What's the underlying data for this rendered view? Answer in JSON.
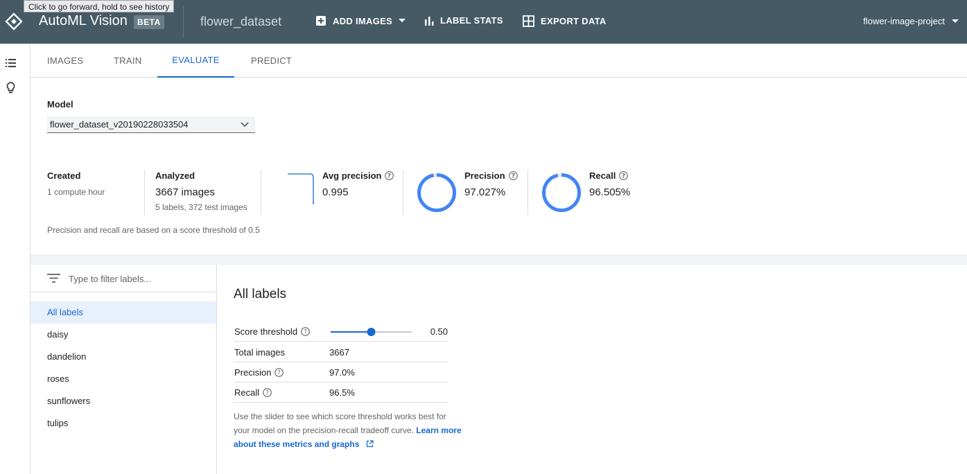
{
  "tooltip": "Click to go forward, hold to see history",
  "app": {
    "title": "AutoML Vision",
    "badge": "BETA",
    "dataset": "flower_dataset",
    "project": "flower-image-project"
  },
  "toolbar": {
    "add_images": "ADD IMAGES",
    "label_stats": "LABEL STATS",
    "export_data": "EXPORT DATA"
  },
  "tabs": [
    "IMAGES",
    "TRAIN",
    "EVALUATE",
    "PREDICT"
  ],
  "active_tab": "EVALUATE",
  "model": {
    "label": "Model",
    "value": "flower_dataset_v20190228033504"
  },
  "stats": {
    "created": {
      "title": "Created",
      "value": "1 compute hour"
    },
    "analyzed": {
      "title": "Analyzed",
      "value": "3667 images",
      "sub": "5 labels, 372 test images"
    },
    "avg_precision": {
      "title": "Avg precision",
      "value": "0.995"
    },
    "precision": {
      "title": "Precision",
      "value": "97.027%"
    },
    "recall": {
      "title": "Recall",
      "value": "96.505%"
    }
  },
  "note": "Precision and recall are based on a score threshold of 0.5",
  "filter": {
    "placeholder": "Type to filter labels..."
  },
  "labels": [
    "All labels",
    "daisy",
    "dandelion",
    "roses",
    "sunflowers",
    "tulips"
  ],
  "detail": {
    "title": "All labels",
    "threshold_label": "Score threshold",
    "threshold_value": "0.50",
    "threshold": 0.5,
    "rows": [
      {
        "k": "Total images",
        "v": "3667"
      },
      {
        "k": "Precision",
        "v": "97.0%"
      },
      {
        "k": "Recall",
        "v": "96.5%"
      }
    ],
    "desc": "Use the slider to see which score threshold works best for your model on the precision-recall tradeoff curve.",
    "link": "Learn more about these metrics and graphs"
  },
  "colors": {
    "topbar": "#455a64",
    "accent": "#1967d2",
    "ring": "#4285f4"
  }
}
